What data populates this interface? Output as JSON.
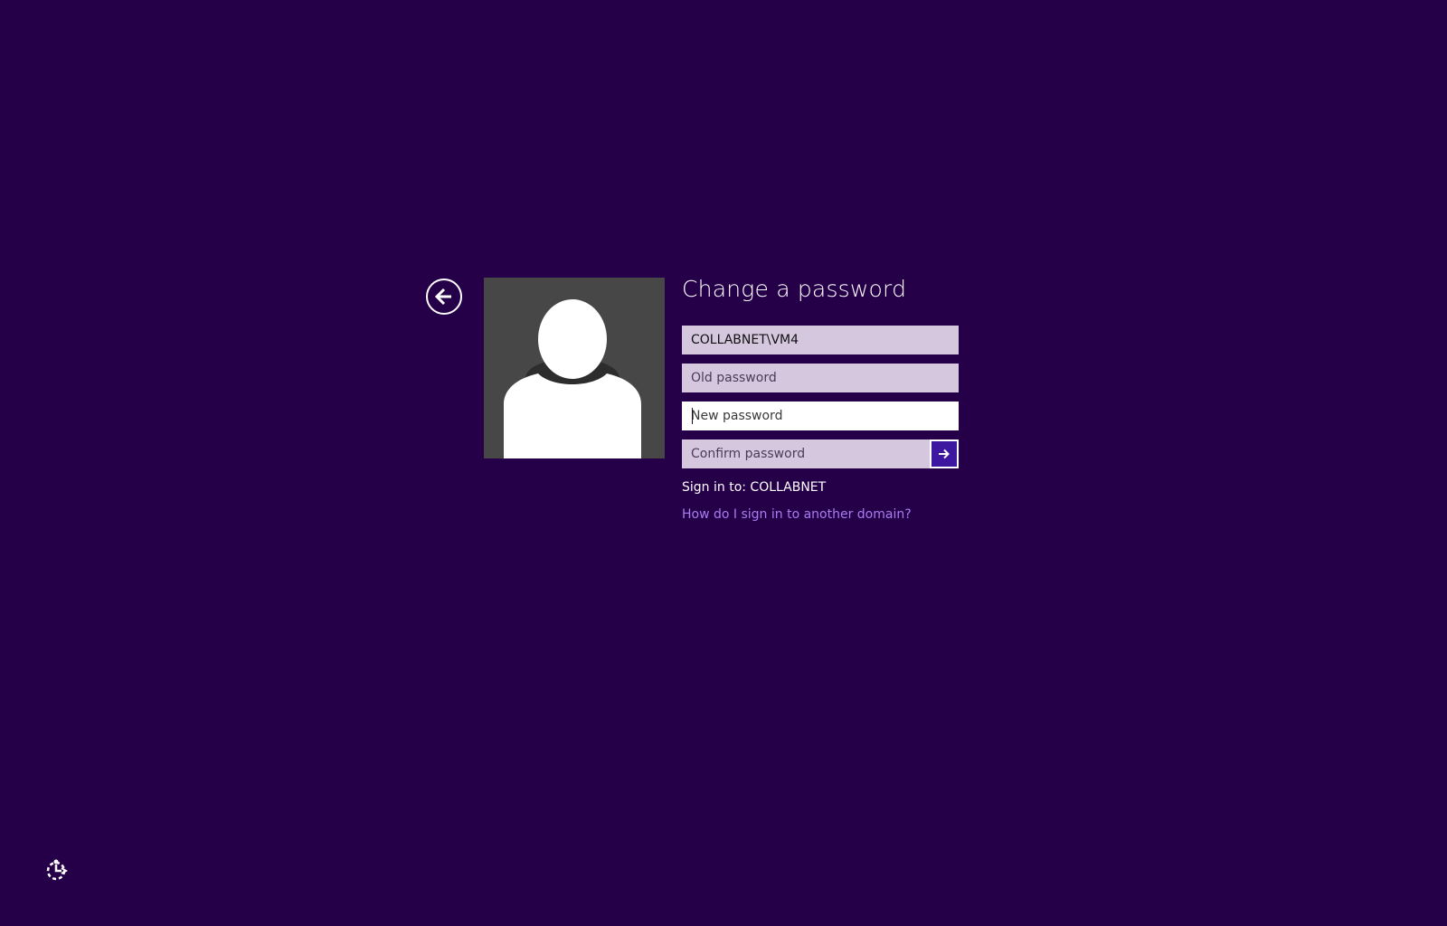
{
  "screen": {
    "background_color": "#250049",
    "title": "Change a password"
  },
  "back_button": {
    "icon": "arrow-left-circle-icon"
  },
  "avatar": {
    "icon": "user-silhouette-icon",
    "background_color": "#474747"
  },
  "form": {
    "username_value": "COLLABNET\\VM4",
    "old_password_placeholder": "Old password",
    "new_password_placeholder": "New password",
    "confirm_password_placeholder": "Confirm password",
    "submit_icon": "arrow-right-icon",
    "submit_color": "#3d17a0",
    "field_color": "#d5c7de"
  },
  "sign_in_to": "Sign in to: COLLABNET",
  "domain_link": {
    "label": "How do I sign in to another domain?",
    "color": "#a77df0"
  },
  "ease_of_access": {
    "icon": "ease-of-access-icon"
  }
}
